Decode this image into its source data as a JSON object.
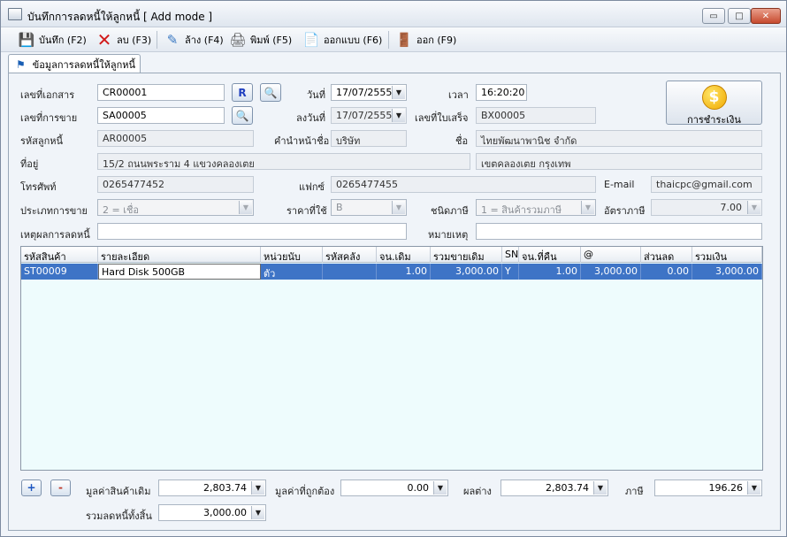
{
  "window": {
    "title": "บันทึกการลดหนี้ให้ลูกหนี้ [ Add mode ]",
    "min": "▭",
    "max": "□",
    "close": "✕"
  },
  "toolbar": {
    "save": "บันทึก (F2)",
    "delete": "ลบ (F3)",
    "clear": "ล้าง (F4)",
    "print": "พิมพ์ (F5)",
    "design": "ออกแบบ (F6)",
    "exit": "ออก (F9)"
  },
  "tab": {
    "label": "ข้อมูลการลดหนี้ให้ลูกหนี้"
  },
  "form": {
    "doc_no_label": "เลขที่เอกสาร",
    "doc_no": "CR00001",
    "r_label": "R",
    "date_label": "วันที่",
    "date": "17/07/2555",
    "time_label": "เวลา",
    "time": "16:20:20",
    "sale_no_label": "เลขที่การขาย",
    "sale_no": "SA00005",
    "sign_date_label": "ลงวันที่",
    "sign_date": "17/07/2555",
    "invoice_label": "เลขที่ใบเสร็จ",
    "invoice": "BX00005",
    "debtor_label": "รหัสลูกหนี้",
    "debtor": "AR00005",
    "prefix_label": "คำนำหน้าชื่อ",
    "prefix": "บริษัท",
    "name_label": "ชื่อ",
    "name": "ไทยพัฒนาพานิช จำกัด",
    "address_label": "ที่อยู่",
    "address1": "15/2 ถนนพระราม 4  แขวงคลองเตย",
    "address2": "เขตคลองเตย  กรุงเทพ",
    "phone_label": "โทรศัพท์",
    "phone": "0265477452",
    "fax_label": "แฟกซ์",
    "fax": "0265477455",
    "email_label": "E-mail",
    "email": "thaicpc@gmail.com",
    "sale_type_label": "ประเภทการขาย",
    "sale_type": "2 = เชื่อ",
    "price_used_label": "ราคาที่ใช้",
    "price_used": "B",
    "tax_type_label": "ชนิดภาษี",
    "tax_type": "1 = สินค้ารวมภาษี",
    "tax_rate_label": "อัตราภาษี",
    "tax_rate": "7.00",
    "reason_label": "เหตุผลการลดหนี้",
    "reason": "",
    "note_label": "หมายเหตุ",
    "note": "",
    "pay_label": "การชำระเงิน",
    "pay_icon": "$"
  },
  "grid": {
    "headers": [
      "รหัสสินค้า",
      "รายละเอียด",
      "หน่วยนับ",
      "รหัสคลัง",
      "จน.เดิม",
      "รวมขายเดิม",
      "SN",
      "จน.ที่คืน",
      "@",
      "ส่วนลด",
      "รวมเงิน"
    ],
    "rows": [
      [
        "ST00009",
        "Hard Disk 500GB",
        "ตัว",
        "",
        "1.00",
        "3,000.00",
        "Y",
        "1.00",
        "3,000.00",
        "0.00",
        "3,000.00"
      ]
    ]
  },
  "footer": {
    "add": "+",
    "remove": "-",
    "orig_value_label": "มูลค่าสินค้าเดิม",
    "orig_value": "2,803.74",
    "correct_value_label": "มูลค่าที่ถูกต้อง",
    "correct_value": "0.00",
    "diff_label": "ผลต่าง",
    "diff": "2,803.74",
    "tax_label": "ภาษี",
    "tax": "196.26",
    "total_label": "รวมลดหนี้ทั้งสิ้น",
    "total": "3,000.00"
  },
  "colors": {
    "selected_row": "#3e74c6",
    "grid_bg": "#eefcfd"
  },
  "icons": [
    "floppy-disk-icon",
    "red-x-icon",
    "broom-icon",
    "printer-icon",
    "document-design-icon",
    "exit-door-icon",
    "search-icon",
    "coin-icon",
    "pin-icon"
  ]
}
